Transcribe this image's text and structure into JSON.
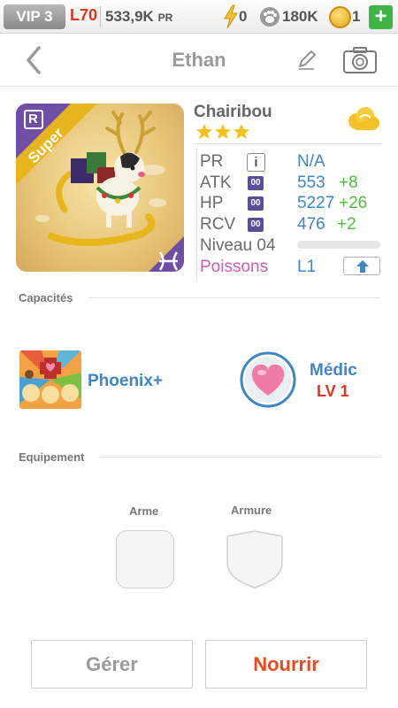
{
  "status": {
    "vip": "VIP 3",
    "level": "L70",
    "power": "533,9K",
    "power_unit": "PR",
    "energy": "0",
    "food": "180K",
    "coins": "1",
    "add": "+"
  },
  "nav": {
    "title": "Ethan"
  },
  "monster": {
    "name": "Chairibou",
    "stars": 3,
    "ribbon": "Super",
    "rarity_letter": "R",
    "stats": {
      "pr_label": "PR",
      "pr_value": "N/A",
      "pr_info": "i",
      "atk_label": "ATK",
      "atk_badge": "00",
      "atk_value": "553",
      "atk_bonus": "+8",
      "hp_label": "HP",
      "hp_badge": "00",
      "hp_value": "5227",
      "hp_bonus": "+26",
      "rcv_label": "RCV",
      "rcv_badge": "00",
      "rcv_value": "476",
      "rcv_bonus": "+2",
      "level_label": "Niveau 04",
      "sign_label": "Poissons",
      "sign_value": "L1"
    }
  },
  "sections": {
    "abilities": "Capacités",
    "equipment": "Equipement"
  },
  "skills": [
    {
      "name": "Phoenix+"
    },
    {
      "name": "Médic",
      "level": "LV 1"
    }
  ],
  "equipment": {
    "weapon": "Arme",
    "armor": "Armure"
  },
  "buttons": {
    "manage": "Gérer",
    "feed": "Nourrir"
  },
  "colors": {
    "accent_blue": "#3f86c7",
    "accent_red": "#e0341f",
    "bonus_green": "#57b848",
    "sign_pink": "#d05bb4"
  }
}
